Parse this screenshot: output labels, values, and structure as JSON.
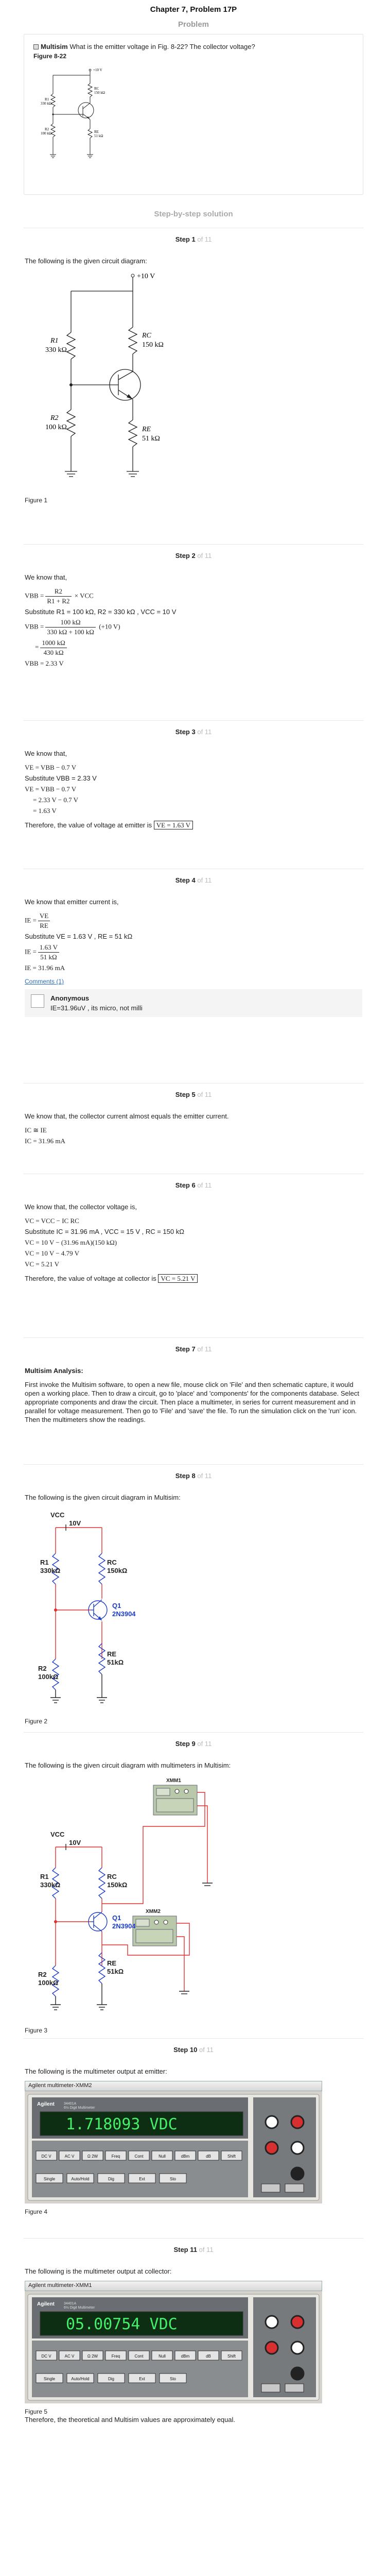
{
  "header": {
    "chapter_title": "Chapter 7, Problem 17P",
    "problem_label": "Problem",
    "solution_label": "Step-by-step solution"
  },
  "problem": {
    "tag": "Multisim",
    "question": " What is the emitter voltage in Fig. 8-22? The collector voltage?",
    "figure_label": "Figure 8-22",
    "fig": {
      "vcc": "+10 V",
      "r1_name": "R1",
      "r1_val": "330 kΩ",
      "rc_name": "RC",
      "rc_val": "150 kΩ",
      "r2_name": "R2",
      "r2_val": "100 kΩ",
      "re_name": "RE",
      "re_val": "51 kΩ"
    }
  },
  "steps": [
    {
      "title": "Step 1",
      "of": "of 11",
      "text": "The following is the given circuit diagram:",
      "caption": "Figure 1"
    },
    {
      "title": "Step 2",
      "of": "of 11",
      "text": "We know that,",
      "eq1_lhs": "VBB =",
      "eq1_num": "R2",
      "eq1_den": "R1 + R2",
      "eq1_tail": " × VCC",
      "subst": "Substitute  R1 = 100 kΩ, R2 = 330 kΩ , VCC = 10 V",
      "eq2_lhs": "VBB =",
      "eq2_num": "100 kΩ",
      "eq2_den": "330 kΩ + 100 kΩ",
      "eq2_tail": " (+10 V)",
      "eq3_lhs": "=",
      "eq3_num": "1000 kΩ",
      "eq3_den": "430 kΩ",
      "result": "VBB = 2.33 V"
    },
    {
      "title": "Step 3",
      "of": "of 11",
      "text": "We know that,",
      "l1": "VE = VBB − 0.7 V",
      "subst": "Substitute  VBB = 2.33 V",
      "l2": "VE = VBB − 0.7 V",
      "l3": "= 2.33 V − 0.7 V",
      "l4": "= 1.63 V",
      "conclusion": "Therefore, the value of voltage at emitter is ",
      "boxed": "VE = 1.63 V"
    },
    {
      "title": "Step 4",
      "of": "of 11",
      "text": "We know that emitter current is,",
      "eq1_lhs": "IE =",
      "eq1_num": "VE",
      "eq1_den": "RE",
      "subst": "Substitute  VE = 1.63 V ,  RE = 51 kΩ",
      "eq2_lhs": "IE =",
      "eq2_num": "1.63 V",
      "eq2_den": "51 kΩ",
      "result": "IE = 31.96 mA",
      "comments_link": "Comments (1)",
      "comment_name": "Anonymous",
      "comment_text": "IE=31.96uV , its micro, not milli"
    },
    {
      "title": "Step 5",
      "of": "of 11",
      "text": "We know that, the collector current almost equals the emitter current.",
      "l1": "IC ≅ IE",
      "l2": "IC = 31.96 mA"
    },
    {
      "title": "Step 6",
      "of": "of 11",
      "text": "We know that, the collector voltage is,",
      "l1": "VC = VCC − IC RC",
      "subst": "Substitute  IC = 31.96 mA ,  VCC = 15 V ,  RC = 150 kΩ",
      "l2": "VC = 10 V − (31.96 mA)(150 kΩ)",
      "l3": "VC = 10 V − 4.79 V",
      "l4": "VC = 5.21 V",
      "conclusion": "Therefore, the value of voltage at collector is ",
      "boxed": "VC = 5.21 V"
    },
    {
      "title": "Step 7",
      "of": "of 11",
      "heading": "Multisim Analysis:",
      "para": "First invoke the Multisim software, to open a new file, mouse click on 'File' and then schematic capture, it would open a working place. Then to draw a circuit, go to 'place' and 'components' for the components database. Select appropriate components and draw the circuit. Then place a multimeter, in series for current measurement and in parallel for voltage measurement. Then go to 'File' and 'save' the file. To run the simulation click on the 'run' icon. Then the multimeters show the readings."
    },
    {
      "title": "Step 8",
      "of": "of 11",
      "text": "The following is the given circuit diagram in Multisim:",
      "caption": "Figure 2",
      "ms": {
        "vcc": "VCC",
        "v10": "10V",
        "r1": "R1",
        "r1v": "330kΩ",
        "rc": "RC",
        "rcv": "150kΩ",
        "q1": "Q1",
        "qpart": "2N3904",
        "r2": "R2",
        "r2v": "100kΩ",
        "re": "RE",
        "rev": "51kΩ"
      }
    },
    {
      "title": "Step 9",
      "of": "of 11",
      "text": "The following is the given circuit diagram with multimeters in Multisim:",
      "caption": "Figure 3",
      "xmm1": "XMM1",
      "xmm2": "XMM2"
    },
    {
      "title": "Step 10",
      "of": "of 11",
      "text": "The following is the multimeter output at emitter:",
      "caption": "Figure 4",
      "meter_title": "Agilent multimeter-XMM2",
      "reading": "1.718093 VDC"
    },
    {
      "title": "Step 11",
      "of": "of 11",
      "text": "The following is the multimeter output at collector:",
      "caption": "Figure 5",
      "meter_title": "Agilent multimeter-XMM1",
      "reading": "05.00754 VDC",
      "final": "Therefore, the theoretical and Multisim values are approximately equal."
    }
  ],
  "meter": {
    "brand": "Agilent",
    "model": "34401A",
    "model_sub": "6½ Digit Multimeter",
    "buttons_row1": [
      "DC V",
      "AC V",
      "Ω 2W",
      "Freq",
      "Cont",
      "Null",
      "dBm",
      "dB",
      "Shift"
    ],
    "buttons_row2": [
      "Single",
      "Auto/Hold",
      "Dig",
      "Ext",
      "Sto"
    ]
  },
  "colors": {
    "wire_red": "#e03030",
    "wire_black": "#222222",
    "comp_blue": "#1d3cc8",
    "lcd_bg": "#0e2e13",
    "lcd_text": "#44f06a"
  }
}
